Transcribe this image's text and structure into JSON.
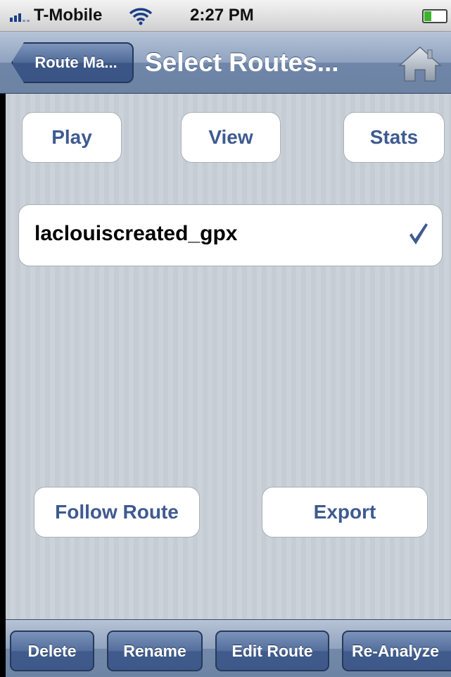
{
  "status_bar": {
    "carrier": "T-Mobile",
    "time": "2:27 PM",
    "wifi_icon": "wifi-icon",
    "battery_icon": "battery-icon"
  },
  "nav_bar": {
    "back_label": "Route Ma...",
    "title": "Select Routes...",
    "home_icon": "home-icon"
  },
  "actions": {
    "play_label": "Play",
    "view_label": "View",
    "stats_label": "Stats",
    "follow_route_label": "Follow Route",
    "export_label": "Export"
  },
  "routes": [
    {
      "name": "laclouiscreated_gpx",
      "selected": true,
      "check_icon": "checkmark-icon"
    }
  ],
  "toolbar": {
    "delete_label": "Delete",
    "rename_label": "Rename",
    "edit_route_label": "Edit Route",
    "reanalyze_label": "Re-Analyze"
  },
  "colors": {
    "nav_blue": "#6d83a4",
    "button_text": "#3e5a90",
    "background_stripe": "#c5ccd4"
  }
}
